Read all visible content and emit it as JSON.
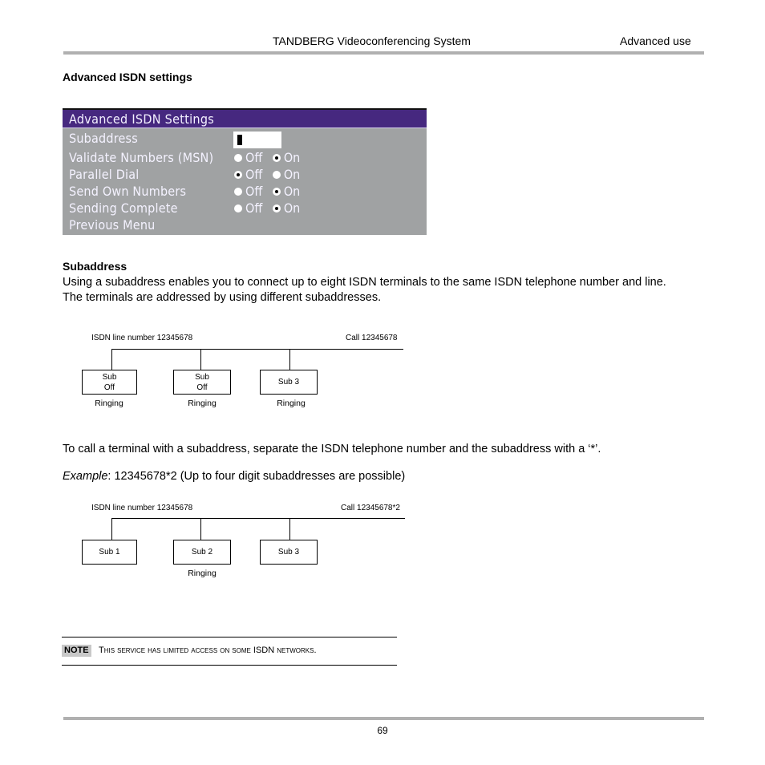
{
  "header": {
    "title": "TANDBERG Videoconferencing System",
    "section": "Advanced use"
  },
  "section_heading": "Advanced ISDN settings",
  "osd_menu": {
    "title": "Advanced ISDN Settings",
    "accent_color": "#46287f",
    "body_color": "#a0a2a3",
    "subaddress_label": "Subaddress",
    "subaddress_value": "",
    "rows": [
      {
        "label": "Validate Numbers (MSN)",
        "off_label": "Off",
        "on_label": "On",
        "selected": "On"
      },
      {
        "label": "Parallel Dial",
        "off_label": "Off",
        "on_label": "On",
        "selected": "Off"
      },
      {
        "label": "Send Own Numbers",
        "off_label": "Off",
        "on_label": "On",
        "selected": "On"
      },
      {
        "label": "Sending Complete",
        "off_label": "Off",
        "on_label": "On",
        "selected": "On"
      }
    ],
    "previous_menu": "Previous Menu"
  },
  "subaddress_section": {
    "heading": "Subaddress",
    "paragraph": "Using a subaddress enables you to connect up to eight ISDN terminals to the same ISDN telephone number and line. The terminals are addressed by using different subaddresses."
  },
  "diagram1": {
    "line_label": "ISDN line number 12345678",
    "call_label": "Call 12345678",
    "terminals": [
      {
        "line1": "Sub",
        "line2": "Off",
        "status": "Ringing"
      },
      {
        "line1": "Sub",
        "line2": "Off",
        "status": "Ringing"
      },
      {
        "line1": "Sub 3",
        "line2": "",
        "status": "Ringing"
      }
    ]
  },
  "call_instruction": "To call a terminal with a subaddress, separate the ISDN telephone number and the subaddress with a ‘*’.",
  "example": {
    "label": "Example",
    "text": ":  12345678*2 (Up to four digit subaddresses are possible)"
  },
  "diagram2": {
    "line_label": "ISDN line number 12345678",
    "call_label": "Call 12345678*2",
    "terminals": [
      {
        "line1": "Sub 1",
        "line2": "",
        "status": ""
      },
      {
        "line1": "Sub 2",
        "line2": "",
        "status": "Ringing"
      },
      {
        "line1": "Sub 3",
        "line2": "",
        "status": ""
      }
    ]
  },
  "note": {
    "badge": "NOTE",
    "text": "This service has limited access on some ISDN networks."
  },
  "footer": {
    "page_number": "69"
  }
}
